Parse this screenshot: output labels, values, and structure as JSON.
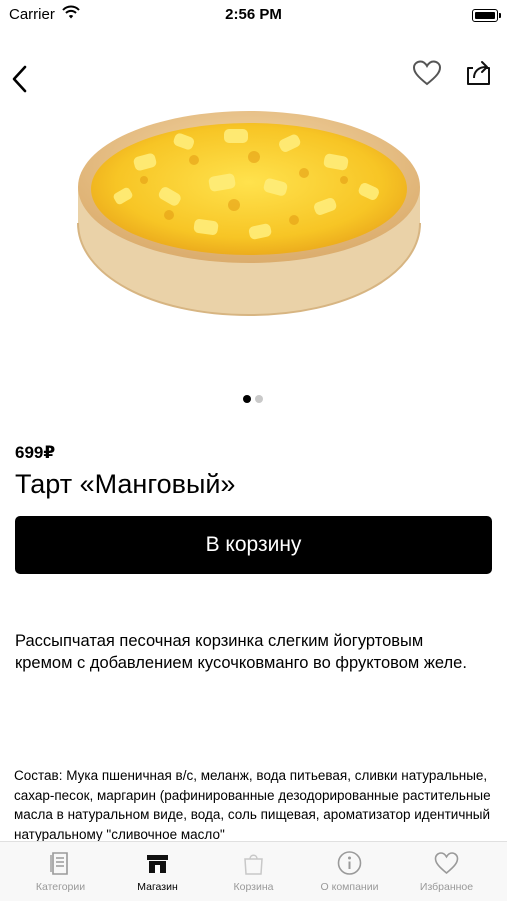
{
  "status_bar": {
    "carrier": "Carrier",
    "time": "2:56 PM"
  },
  "product": {
    "price": "699₽",
    "title": "Тарт «Манговый»",
    "add_to_cart_label": "В корзину",
    "description": "Рассыпчатая песочная корзинка слегким йогуртовым кремом с добавлением кусочковманго во фруктовом желе.",
    "composition": "Состав: Мука пшеничная в/с, меланж, вода питьевая, сливки натуральные, сахар-песок, маргарин (рафинированные дезодорированные растительные масла в натуральном виде, вода, соль пищевая, ароматизатор идентичный натуральному \"сливочное масло\"",
    "image_pager": {
      "current": 1,
      "total": 2
    }
  },
  "tab_bar": {
    "tabs": [
      {
        "label": "Категории",
        "icon": "catalog-icon",
        "selected": false
      },
      {
        "label": "Магазин",
        "icon": "store-icon",
        "selected": true
      },
      {
        "label": "Корзина",
        "icon": "bag-icon",
        "selected": false
      },
      {
        "label": "О компании",
        "icon": "info-icon",
        "selected": false
      },
      {
        "label": "Избранное",
        "icon": "heart-icon",
        "selected": false
      }
    ]
  },
  "colors": {
    "accent": "#000000",
    "inactive_tab": "#999999",
    "tab_bar_bg": "#f8f8f8"
  }
}
